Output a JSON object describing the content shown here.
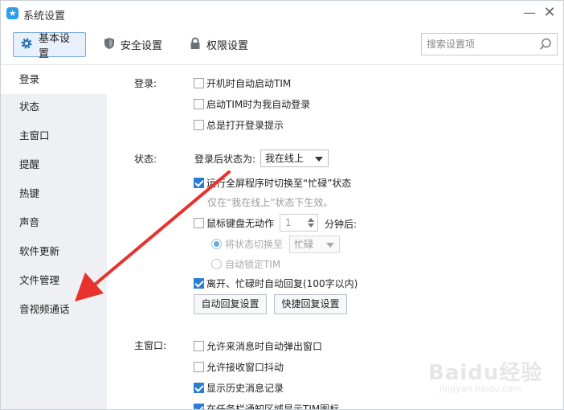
{
  "window": {
    "title": "系统设置",
    "app_icon_glyph": "★",
    "minimize_glyph": "—",
    "close_glyph": "✕"
  },
  "toolbar": {
    "tabs": [
      {
        "label": "基本设置",
        "icon": "gear-icon",
        "active": true
      },
      {
        "label": "安全设置",
        "icon": "shield-icon",
        "active": false
      },
      {
        "label": "权限设置",
        "icon": "lock-icon",
        "active": false
      }
    ],
    "search_placeholder": "搜索设置项"
  },
  "sidebar": {
    "items": [
      {
        "label": "登录",
        "active": true
      },
      {
        "label": "状态",
        "active": false
      },
      {
        "label": "主窗口",
        "active": false
      },
      {
        "label": "提醒",
        "active": false
      },
      {
        "label": "热键",
        "active": false
      },
      {
        "label": "声音",
        "active": false
      },
      {
        "label": "软件更新",
        "active": false
      },
      {
        "label": "文件管理",
        "active": false
      },
      {
        "label": "音视频通话",
        "active": false
      }
    ]
  },
  "login": {
    "label": "登录:",
    "options": [
      {
        "label": "开机时自动启动TIM",
        "checked": false
      },
      {
        "label": "启动TIM时为我自动登录",
        "checked": false
      },
      {
        "label": "总是打开登录提示",
        "checked": false
      }
    ]
  },
  "status": {
    "label": "状态:",
    "after_login_label": "登录后状态为:",
    "after_login_value": "我在线上",
    "fullscreen_busy": {
      "label": "运行全屏程序时切换至“忙碌”状态",
      "checked": true
    },
    "fullscreen_hint": "仅在“我在线上”状态下生效。",
    "idle": {
      "label": "鼠标键盘无动作",
      "checked": false,
      "minutes": "1",
      "suffix": "分钟后:"
    },
    "idle_switch": {
      "label": "将状态切换至",
      "selected": true,
      "value": "忙碌"
    },
    "idle_lock": {
      "label": "自动锁定TIM",
      "selected": false
    },
    "auto_reply": {
      "label": "离开、忙碌时自动回复(100字以内)",
      "checked": true
    },
    "buttons": {
      "auto_reply_settings": "自动回复设置",
      "quick_reply_settings": "快捷回复设置"
    }
  },
  "main_window": {
    "label": "主窗口:",
    "options": [
      {
        "label": "允许来消息时自动弹出窗口",
        "checked": false
      },
      {
        "label": "允许接收窗口抖动",
        "checked": false
      },
      {
        "label": "显示历史消息记录",
        "checked": true
      },
      {
        "label": "在任务栏通知区域显示TIM图标",
        "checked": true
      }
    ]
  },
  "watermark": {
    "main": "Baidu经验",
    "sub": "jingyan.baidu.com"
  },
  "colors": {
    "accent": "#2b7cd3",
    "arrow": "#e8322d",
    "sidebar_bg": "#eef0f3"
  }
}
